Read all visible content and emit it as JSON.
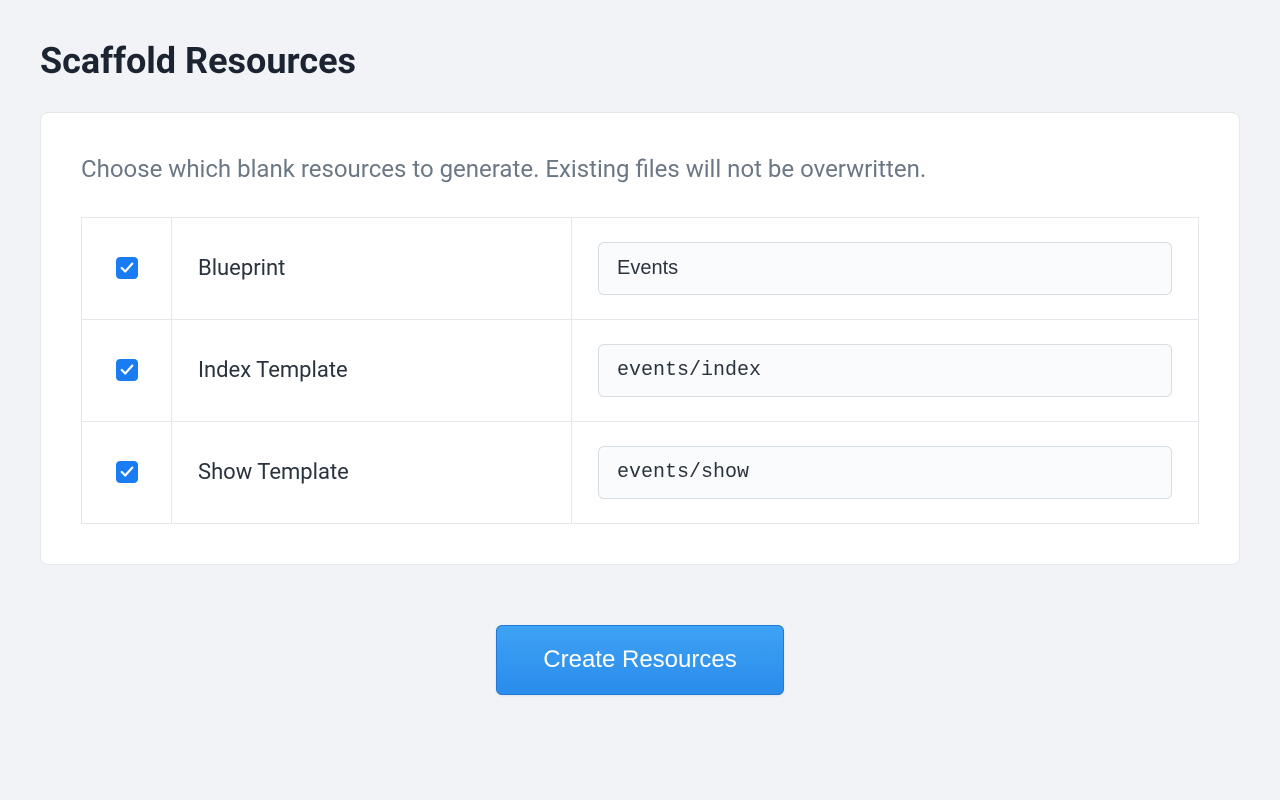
{
  "page": {
    "title": "Scaffold Resources"
  },
  "card": {
    "description": "Choose which blank resources to generate. Existing files will not be overwritten."
  },
  "resources": {
    "blueprint": {
      "label": "Blueprint",
      "checked": true,
      "value": "Events"
    },
    "index_template": {
      "label": "Index Template",
      "checked": true,
      "value": "events/index"
    },
    "show_template": {
      "label": "Show Template",
      "checked": true,
      "value": "events/show"
    }
  },
  "actions": {
    "create_label": "Create Resources"
  }
}
